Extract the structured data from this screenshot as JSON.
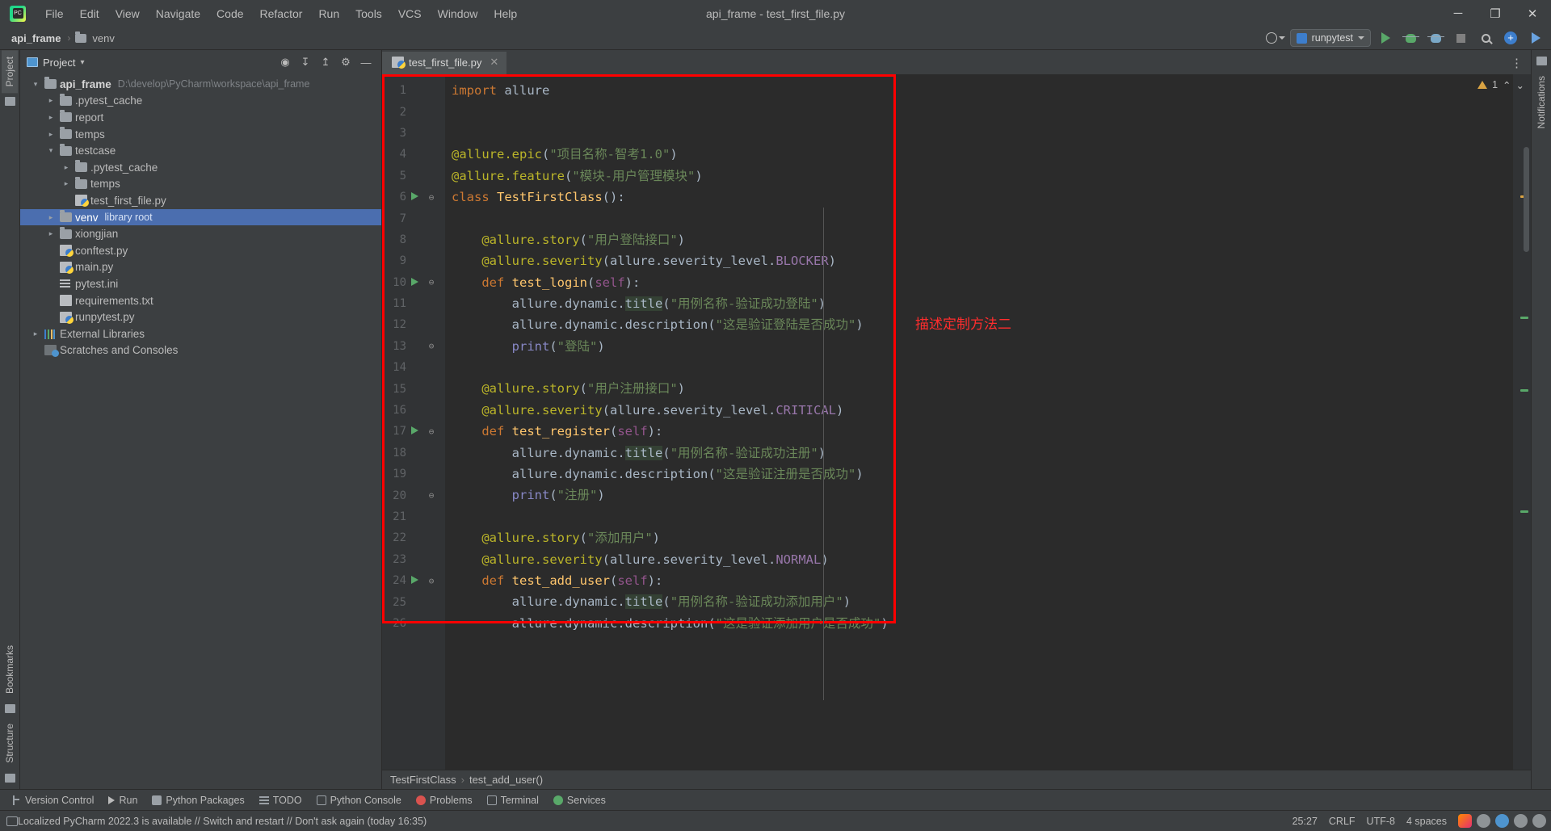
{
  "window": {
    "title": "api_frame - test_first_file.py",
    "logo_text": "PC",
    "minimize": "─",
    "maximize": "❐",
    "close": "✕"
  },
  "menubar": {
    "items": [
      "File",
      "Edit",
      "View",
      "Navigate",
      "Code",
      "Refactor",
      "Run",
      "Tools",
      "VCS",
      "Window",
      "Help"
    ]
  },
  "breadcrumb": {
    "project": "api_frame",
    "separator": "›",
    "folder": "venv"
  },
  "navbar_right": {
    "run_config": "runpytest",
    "icons": [
      "user-icon",
      "run-icon",
      "debug-icon",
      "coverage-icon",
      "stop-icon",
      "search-icon",
      "plus-icon",
      "updates-icon"
    ]
  },
  "left_rail": {
    "items": [
      "Project",
      "Bookmarks",
      "Structure"
    ]
  },
  "right_rail": {
    "items": [
      "Notifications"
    ]
  },
  "sidebar": {
    "title": "Project",
    "dropdown_caret": "▾",
    "action_icons": [
      "locate-icon",
      "expand-all-icon",
      "collapse-all-icon",
      "settings-gear-icon",
      "hide-icon"
    ],
    "tree": [
      {
        "depth": 0,
        "arrow": "open",
        "icon": "folder",
        "name": "api_frame",
        "bold": true,
        "path": "D:\\develop\\PyCharm\\workspace\\api_frame",
        "selected": false
      },
      {
        "depth": 1,
        "arrow": "closed",
        "icon": "folder",
        "name": ".pytest_cache",
        "bold": false,
        "path": "",
        "selected": false
      },
      {
        "depth": 1,
        "arrow": "closed",
        "icon": "folder",
        "name": "report",
        "bold": false,
        "path": "",
        "selected": false
      },
      {
        "depth": 1,
        "arrow": "closed",
        "icon": "folder",
        "name": "temps",
        "bold": false,
        "path": "",
        "selected": false
      },
      {
        "depth": 1,
        "arrow": "open",
        "icon": "folder",
        "name": "testcase",
        "bold": false,
        "path": "",
        "selected": false
      },
      {
        "depth": 2,
        "arrow": "closed",
        "icon": "folder",
        "name": ".pytest_cache",
        "bold": false,
        "path": "",
        "selected": false
      },
      {
        "depth": 2,
        "arrow": "closed",
        "icon": "folder",
        "name": "temps",
        "bold": false,
        "path": "",
        "selected": false
      },
      {
        "depth": 2,
        "arrow": "none",
        "icon": "py",
        "name": "test_first_file.py",
        "bold": false,
        "path": "",
        "selected": false
      },
      {
        "depth": 1,
        "arrow": "closed",
        "icon": "folder",
        "name": "venv",
        "bold": false,
        "path": "library root",
        "selected": true
      },
      {
        "depth": 1,
        "arrow": "closed",
        "icon": "folder",
        "name": "xiongjian",
        "bold": false,
        "path": "",
        "selected": false
      },
      {
        "depth": 1,
        "arrow": "none",
        "icon": "py",
        "name": "conftest.py",
        "bold": false,
        "path": "",
        "selected": false
      },
      {
        "depth": 1,
        "arrow": "none",
        "icon": "py",
        "name": "main.py",
        "bold": false,
        "path": "",
        "selected": false
      },
      {
        "depth": 1,
        "arrow": "none",
        "icon": "ini",
        "name": "pytest.ini",
        "bold": false,
        "path": "",
        "selected": false
      },
      {
        "depth": 1,
        "arrow": "none",
        "icon": "txt",
        "name": "requirements.txt",
        "bold": false,
        "path": "",
        "selected": false
      },
      {
        "depth": 1,
        "arrow": "none",
        "icon": "py",
        "name": "runpytest.py",
        "bold": false,
        "path": "",
        "selected": false
      },
      {
        "depth": 0,
        "arrow": "closed",
        "icon": "lib",
        "name": "External Libraries",
        "bold": false,
        "path": "",
        "selected": false
      },
      {
        "depth": 0,
        "arrow": "none",
        "icon": "scratch",
        "name": "Scratches and Consoles",
        "bold": false,
        "path": "",
        "selected": false
      }
    ]
  },
  "tabs": [
    {
      "label": "test_first_file.py",
      "icon": "python-file-icon",
      "close": "✕",
      "active": true
    }
  ],
  "editor": {
    "inspection_warning_count": "1",
    "inspection_up": "⌃",
    "inspection_down": "⌄",
    "lines": [
      {
        "n": "1",
        "run": false,
        "fold": "",
        "text": "import allure"
      },
      {
        "n": "2",
        "run": false,
        "fold": "",
        "text": ""
      },
      {
        "n": "3",
        "run": false,
        "fold": "",
        "text": ""
      },
      {
        "n": "4",
        "run": false,
        "fold": "",
        "text": "@allure.epic(\"项目名称-智考1.0\")"
      },
      {
        "n": "5",
        "run": false,
        "fold": "",
        "text": "@allure.feature(\"模块-用户管理模块\")"
      },
      {
        "n": "6",
        "run": true,
        "fold": "⊖",
        "text": "class TestFirstClass():"
      },
      {
        "n": "7",
        "run": false,
        "fold": "",
        "text": ""
      },
      {
        "n": "8",
        "run": false,
        "fold": "",
        "text": "    @allure.story(\"用户登陆接口\")"
      },
      {
        "n": "9",
        "run": false,
        "fold": "",
        "text": "    @allure.severity(allure.severity_level.BLOCKER)"
      },
      {
        "n": "10",
        "run": true,
        "fold": "⊖",
        "text": "    def test_login(self):"
      },
      {
        "n": "11",
        "run": false,
        "fold": "",
        "text": "        allure.dynamic.title(\"用例名称-验证成功登陆\")"
      },
      {
        "n": "12",
        "run": false,
        "fold": "",
        "text": "        allure.dynamic.description(\"这是验证登陆是否成功\")"
      },
      {
        "n": "13",
        "run": false,
        "fold": "⊖",
        "text": "        print(\"登陆\")"
      },
      {
        "n": "14",
        "run": false,
        "fold": "",
        "text": ""
      },
      {
        "n": "15",
        "run": false,
        "fold": "",
        "text": "    @allure.story(\"用户注册接口\")"
      },
      {
        "n": "16",
        "run": false,
        "fold": "",
        "text": "    @allure.severity(allure.severity_level.CRITICAL)"
      },
      {
        "n": "17",
        "run": true,
        "fold": "⊖",
        "text": "    def test_register(self):"
      },
      {
        "n": "18",
        "run": false,
        "fold": "",
        "text": "        allure.dynamic.title(\"用例名称-验证成功注册\")"
      },
      {
        "n": "19",
        "run": false,
        "fold": "",
        "text": "        allure.dynamic.description(\"这是验证注册是否成功\")"
      },
      {
        "n": "20",
        "run": false,
        "fold": "⊖",
        "text": "        print(\"注册\")"
      },
      {
        "n": "21",
        "run": false,
        "fold": "",
        "text": ""
      },
      {
        "n": "22",
        "run": false,
        "fold": "",
        "text": "    @allure.story(\"添加用户\")"
      },
      {
        "n": "23",
        "run": false,
        "fold": "",
        "text": "    @allure.severity(allure.severity_level.NORMAL)"
      },
      {
        "n": "24",
        "run": true,
        "fold": "⊖",
        "text": "    def test_add_user(self):"
      },
      {
        "n": "25",
        "run": false,
        "fold": "",
        "text": "        allure.dynamic.title(\"用例名称-验证成功添加用户\")"
      },
      {
        "n": "26",
        "run": false,
        "fold": "",
        "text": "        allure.dynamic.description(\"这是验证添加用户是否成功\")"
      }
    ]
  },
  "annotation": {
    "text": "描述定制方法二",
    "color": "#ff2d2d",
    "box_color": "#ff0000"
  },
  "editor_breadcrumb": {
    "class": "TestFirstClass",
    "separator": "›",
    "method": "test_add_user()"
  },
  "bottom_toolwindows": [
    {
      "label": "Version Control",
      "icon": "version-control-icon"
    },
    {
      "label": "Run",
      "icon": "run-icon"
    },
    {
      "label": "Python Packages",
      "icon": "python-packages-icon"
    },
    {
      "label": "TODO",
      "icon": "todo-icon"
    },
    {
      "label": "Python Console",
      "icon": "python-console-icon"
    },
    {
      "label": "Problems",
      "icon": "problems-icon"
    },
    {
      "label": "Terminal",
      "icon": "terminal-icon"
    },
    {
      "label": "Services",
      "icon": "services-icon"
    }
  ],
  "statusbar": {
    "message": "Localized PyCharm 2022.3 is available // Switch and restart // Don't ask again (today 16:35)",
    "caret": "25:27",
    "line_sep": "CRLF",
    "encoding": "UTF-8",
    "indent": "4 spaces",
    "tray_icons": [
      "sogou-input-icon",
      "emoji-icon",
      "volume-icon",
      "network-icon",
      "battery-icon"
    ]
  }
}
